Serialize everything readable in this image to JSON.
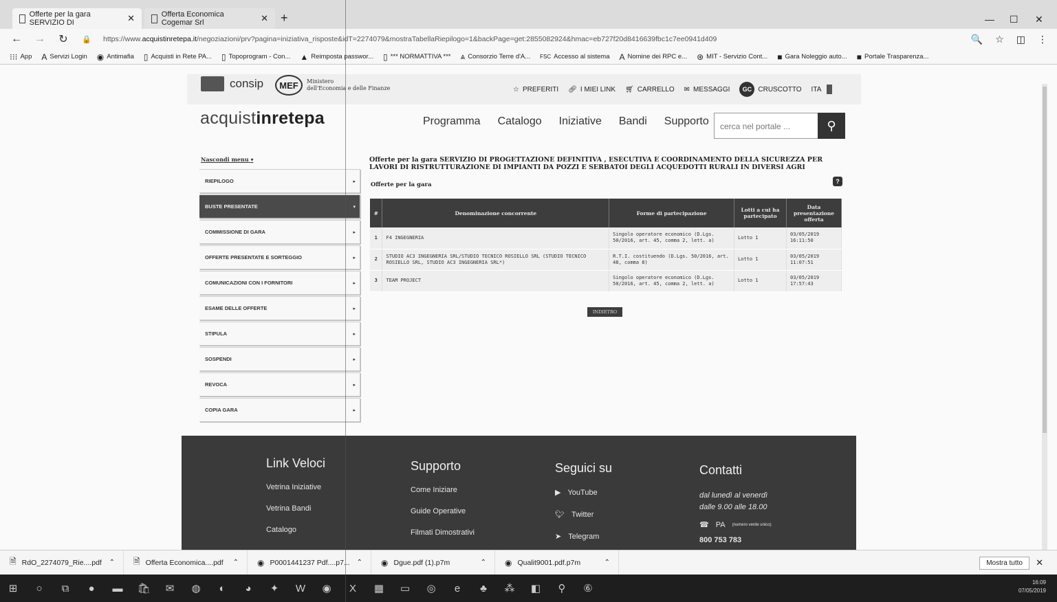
{
  "browser": {
    "tabs": [
      {
        "title": "Offerte per la gara SERVIZIO DI"
      },
      {
        "title": "Offerta Economica Cogemar Srl"
      }
    ],
    "url_prefix": "https://www.",
    "url_domain": "acquistinretepa.it",
    "url_rest": "/negoziazioni/prv?pagina=iniziativa_risposte&idT=2274079&mostraTabellaRiepilogo=1&backPage=get:2855082924&hmac=eb727f20d8416639fbc1c7ee0941d409",
    "bookmarks": [
      "App",
      "Servizi Login",
      "Antimafia",
      "Acquisti in Rete PA...",
      "Topoprogram - Con...",
      "Reimposta passwor...",
      "*** NORMATTIVA ***",
      "Consorzio Terre d'A...",
      "Accesso al sistema",
      "Nomine dei RPC e...",
      "MIT - Servizio Cont...",
      "Gara Noleggio auto...",
      "Portale Trasparenza..."
    ]
  },
  "header": {
    "consip": "consip",
    "mef": "MEF",
    "mef_text_1": "Ministero",
    "mef_text_2": "dell'Economia e delle Finanze",
    "links": {
      "preferiti": "PREFERITI",
      "miei_link": "I MIEI LINK",
      "carrello": "CARRELLO",
      "messaggi": "MESSAGGI",
      "avatar": "GC",
      "cruscotto": "CRUSCOTTO",
      "lang": "ITA"
    },
    "brand_pre": "acquist",
    "brand_bold": "inrete",
    "brand_post": "pa",
    "nav": [
      "Programma",
      "Catalogo",
      "Iniziative",
      "Bandi",
      "Supporto"
    ],
    "search_placeholder": "cerca nel portale ..."
  },
  "sidebar": {
    "hide_label": "Nascondi menu",
    "items": [
      {
        "label": "RIEPILOGO",
        "active": false
      },
      {
        "label": "BUSTE PRESENTATE",
        "active": true
      },
      {
        "label": "COMMISSIONE DI GARA",
        "active": false
      },
      {
        "label": "OFFERTE PRESENTATE E SORTEGGIO",
        "active": false
      },
      {
        "label": "COMUNICAZIONI CON I FORNITORI",
        "active": false
      },
      {
        "label": "ESAME DELLE OFFERTE",
        "active": false
      },
      {
        "label": "STIPULA",
        "active": false
      },
      {
        "label": "SOSPENDI",
        "active": false
      },
      {
        "label": "REVOCA",
        "active": false
      },
      {
        "label": "COPIA GARA",
        "active": false
      }
    ]
  },
  "main": {
    "title": "Offerte per la gara SERVIZIO DI PROGETTAZIONE DEFINITIVA , ESECUTIVA E COORDINAMENTO DELLA SICUREZZA PER LAVORI DI RISTRUTTURAZIONE DI IMPIANTI DA POZZI E SERBATOI DEGLI ACQUEDOTTI RURALI IN DIVERSI AGRI",
    "subtitle": "Offerte per la gara",
    "table": {
      "headers": [
        "#",
        "Denominazione concorrente",
        "Forme di partecipazione",
        "Lotti a cui ha partecipato",
        "Data presentazione offerta"
      ],
      "rows": [
        {
          "n": "1",
          "name": "F4 INGEGNERIA",
          "forma": "Singolo operatore economico (D.Lgs. 50/2016, art. 45, comma 2, lett. a)",
          "lotti": "Lotto 1",
          "data": "03/05/2019 16:11:50"
        },
        {
          "n": "2",
          "name": "STUDIO AC3 INGEGNERIA SRL/STUDIO TECNICO ROSIELLO SRL (STUDIO TECNICO ROSIELLO SRL, STUDIO AC3 INGEGNERIA SRL*)",
          "forma": "R.T.I. costituendo (D.Lgs. 50/2016, art. 48, comma 8)",
          "lotti": "Lotto 1",
          "data": "03/05/2019 11:07:51"
        },
        {
          "n": "3",
          "name": "TEAM PROJECT",
          "forma": "Singolo operatore economico (D.Lgs. 50/2016, art. 45, comma 2, lett. a)",
          "lotti": "Lotto 1",
          "data": "03/05/2019 17:57:43"
        }
      ]
    },
    "back_button": "INDIETRO"
  },
  "footer": {
    "link_veloci": {
      "title": "Link Veloci",
      "items": [
        "Vetrina Iniziative",
        "Vetrina Bandi",
        "Catalogo"
      ]
    },
    "supporto": {
      "title": "Supporto",
      "items": [
        "Come Iniziare",
        "Guide Operative",
        "Filmati Dimostrativi"
      ]
    },
    "seguici": {
      "title": "Seguici su",
      "items": [
        "YouTube",
        "Twitter",
        "Telegram"
      ]
    },
    "contatti": {
      "title": "Contatti",
      "hours_1": "dal lunedì al venerdì",
      "hours_2": "dalle 9.00 alle 18.00",
      "pa": "PA",
      "pa_note": "(numero verde unico)",
      "phone": "800 753 783"
    }
  },
  "downloads": {
    "items": [
      "RdO_2274079_Rie....pdf",
      "Offerta Economica....pdf",
      "P0001441237 Pdf....p7...",
      "Dgue.pdf (1).p7m",
      "Qualit9001.pdf.p7m"
    ],
    "show_all": "Mostra tutto"
  },
  "taskbar": {
    "time": "16:09",
    "date": "07/05/2019"
  }
}
